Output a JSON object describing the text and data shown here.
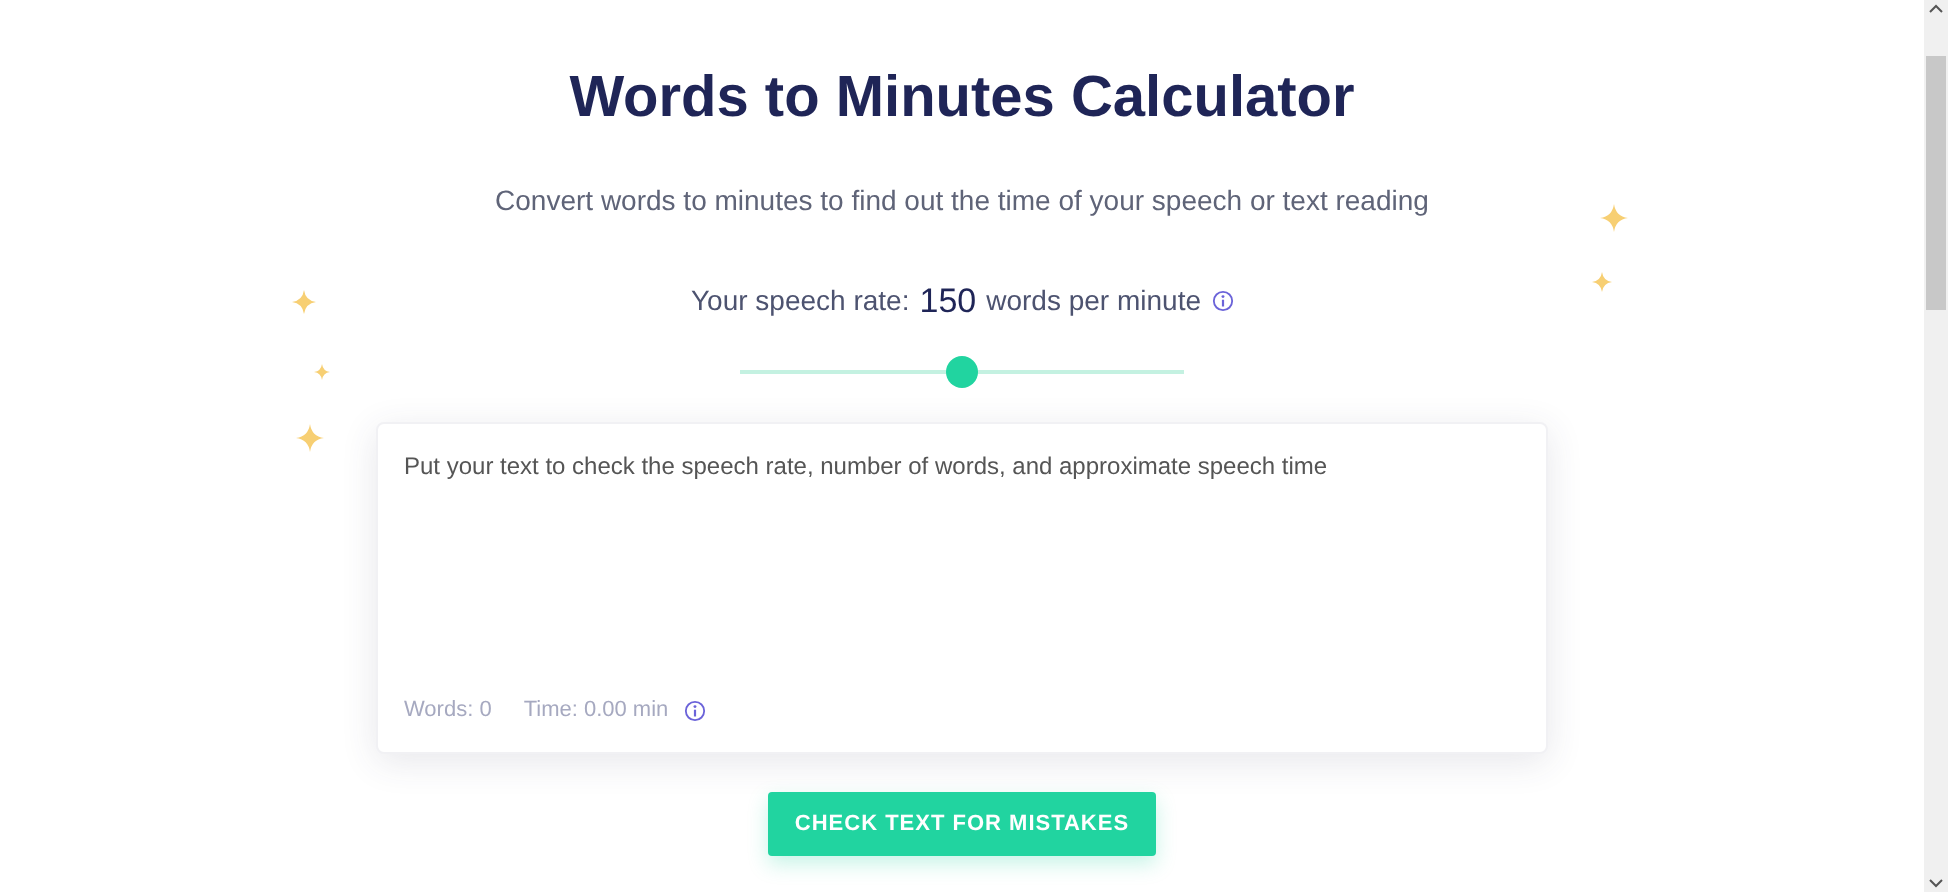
{
  "title": "Words to Minutes Calculator",
  "subtitle": "Convert words to minutes to find out the time of your speech or text reading",
  "speech_rate": {
    "label": "Your speech rate:",
    "value": "150",
    "unit": "words per minute"
  },
  "rate_slider": {
    "level": 0.5
  },
  "text_input": {
    "placeholder": "Put your text to check the speech rate, number of words, and approximate speech time"
  },
  "stats": {
    "words": "Words: 0",
    "time": "Time: 0.00 min"
  },
  "button": "CHECK TEXT FOR MISTAKES"
}
